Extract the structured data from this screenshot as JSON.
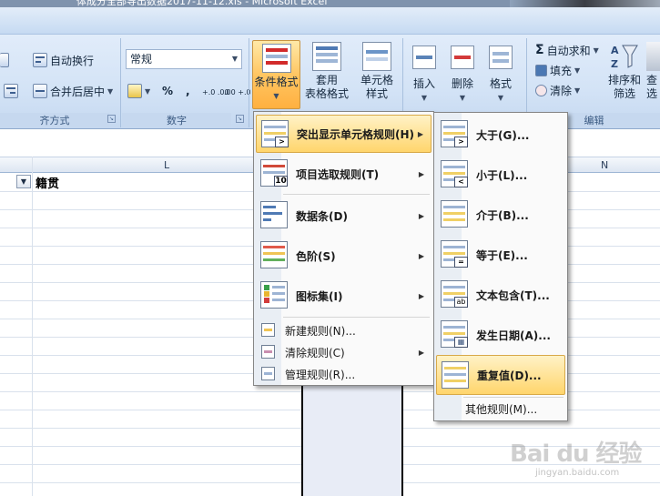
{
  "window": {
    "title": "体成分全部导出数据2017-11-12.xls - Microsoft Excel"
  },
  "ribbon": {
    "alignment": {
      "wrap_text": "自动换行",
      "merge_center": "合并后居中",
      "group_label": "齐方式"
    },
    "number": {
      "format_value": "常规",
      "percent": "%",
      "comma": ",",
      "inc_decimal": "+.0 .00",
      "dec_decimal": ".00 +.0",
      "group_label": "数字"
    },
    "styles": {
      "conditional_format": "条件格式",
      "format_as_table_1": "套用",
      "format_as_table_2": "表格格式",
      "cell_styles_1": "单元格",
      "cell_styles_2": "样式"
    },
    "cells": {
      "insert": "插入",
      "delete": "删除",
      "format": "格式"
    },
    "editing": {
      "autosum": "自动求和",
      "fill": "填充",
      "clear": "清除",
      "sort_filter_1": "排序和",
      "sort_filter_2": "筛选",
      "find_1": "查",
      "find_2": "选",
      "group_label": "编辑",
      "sigma": "Σ"
    }
  },
  "sheet": {
    "col_L": "L",
    "col_N": "N",
    "cell_header": "籍贯"
  },
  "cf_menu": {
    "items": [
      {
        "label": "突出显示单元格规则(H)"
      },
      {
        "label": "项目选取规则(T)"
      },
      {
        "label": "数据条(D)"
      },
      {
        "label": "色阶(S)"
      },
      {
        "label": "图标集(I)"
      },
      {
        "label": "新建规则(N)..."
      },
      {
        "label": "清除规则(C)"
      },
      {
        "label": "管理规则(R)..."
      }
    ]
  },
  "highlight_menu": {
    "items": [
      {
        "label": "大于(G)...",
        "symbol": ">"
      },
      {
        "label": "小于(L)...",
        "symbol": "<"
      },
      {
        "label": "介于(B)...",
        "symbol": ""
      },
      {
        "label": "等于(E)...",
        "symbol": "="
      },
      {
        "label": "文本包含(T)...",
        "symbol": "ab"
      },
      {
        "label": "发生日期(A)...",
        "symbol": "▦"
      },
      {
        "label": "重复值(D)...",
        "symbol": ""
      },
      {
        "label": "其他规则(M)..."
      }
    ]
  },
  "watermark": {
    "logo": "Bai du 经验",
    "url": "jingyan.baidu.com"
  }
}
